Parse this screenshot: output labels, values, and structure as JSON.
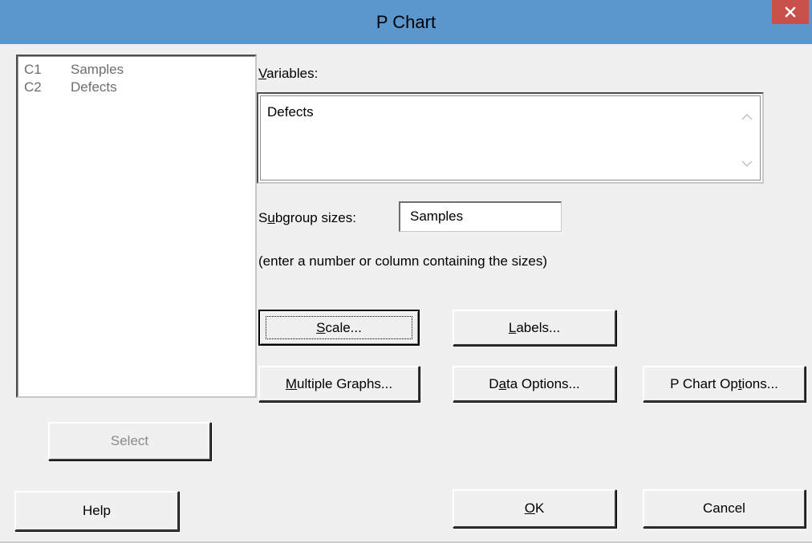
{
  "window": {
    "title": "P Chart",
    "close_icon": "close-icon"
  },
  "columns": [
    {
      "id": "C1",
      "name": "Samples"
    },
    {
      "id": "C2",
      "name": "Defects"
    }
  ],
  "variables": {
    "label_prefix": "",
    "label_u": "V",
    "label_rest": "ariables:",
    "value": "Defects"
  },
  "subgroup": {
    "label_pre": "S",
    "label_u": "u",
    "label_rest": "bgroup sizes:",
    "value": "Samples",
    "hint": "(enter a number or column containing the sizes)"
  },
  "buttons": {
    "scale": {
      "u": "S",
      "rest": "cale..."
    },
    "labels": {
      "u": "L",
      "rest": "abels..."
    },
    "multiple_graphs": {
      "u": "M",
      "rest": "ultiple Graphs..."
    },
    "data_options_pre": "D",
    "data_options_u": "a",
    "data_options_rest": "ta Options...",
    "p_chart_options_pre": "P Chart Op",
    "p_chart_options_u": "t",
    "p_chart_options_rest": "ions...",
    "select": "Select",
    "help": "Help",
    "ok": {
      "u": "O",
      "rest": "K"
    },
    "cancel": "Cancel"
  }
}
